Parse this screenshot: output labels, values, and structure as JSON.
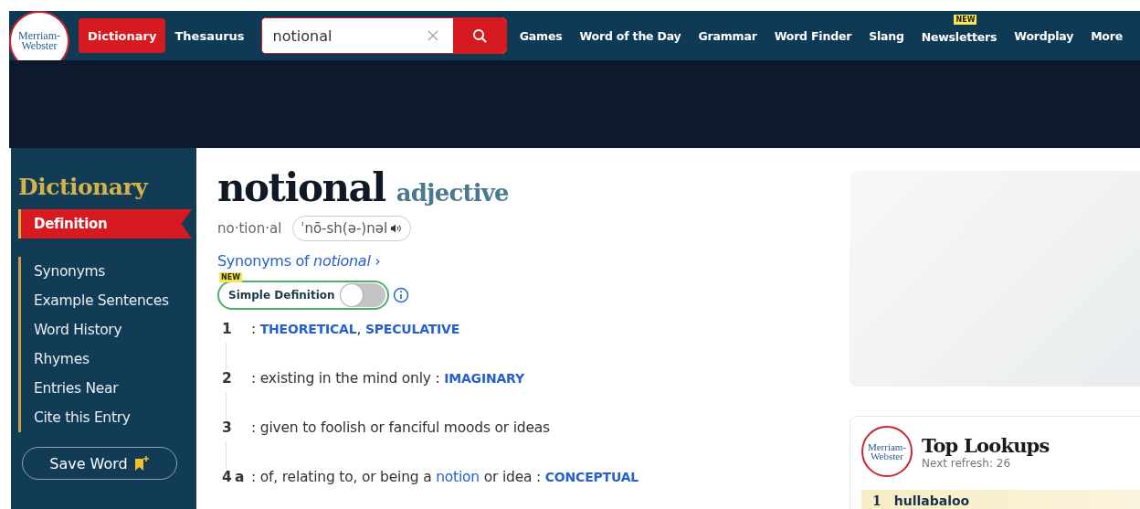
{
  "header": {
    "logo": [
      "Merriam-",
      "Webster"
    ],
    "tabs": [
      {
        "label": "Dictionary",
        "selected": true
      },
      {
        "label": "Thesaurus",
        "selected": false
      }
    ],
    "search": {
      "value": "notional"
    },
    "nav": [
      {
        "label": "Games"
      },
      {
        "label": "Word of the Day"
      },
      {
        "label": "Grammar"
      },
      {
        "label": "Word Finder"
      },
      {
        "label": "Slang"
      },
      {
        "label": "Newsletters",
        "badge": "NEW"
      },
      {
        "label": "Wordplay"
      },
      {
        "label": "More"
      }
    ]
  },
  "sidebar": {
    "title": "Dictionary",
    "items": [
      {
        "label": "Definition",
        "selected": true
      },
      {
        "label": "Synonyms",
        "selected": false
      },
      {
        "label": "Example Sentences",
        "selected": false
      },
      {
        "label": "Word History",
        "selected": false
      },
      {
        "label": "Rhymes",
        "selected": false
      },
      {
        "label": "Entries Near",
        "selected": false
      },
      {
        "label": "Cite this Entry",
        "selected": false
      }
    ],
    "save_button": "Save Word"
  },
  "entry": {
    "headword": "notional",
    "pos": "adjective",
    "syllables": "no·tion·al",
    "pronunciation": "ˈnō-sh(ə-)nəl",
    "synonyms_link": {
      "text": "Synonyms of ",
      "word": "notional",
      "arrow": "›"
    },
    "simple_definition": {
      "badge": "NEW",
      "label": "Simple Definition",
      "on": false
    },
    "senses": [
      {
        "number": "1",
        "parts": [
          {
            "kind": "text",
            "text": ": "
          },
          {
            "kind": "xref",
            "text": "THEORETICAL"
          },
          {
            "kind": "text",
            "text": ", "
          },
          {
            "kind": "xref",
            "text": "SPECULATIVE"
          }
        ]
      },
      {
        "number": "2",
        "parts": [
          {
            "kind": "text",
            "text": ": existing in the mind only "
          },
          {
            "kind": "text",
            "text": ": "
          },
          {
            "kind": "xref",
            "text": "IMAGINARY"
          }
        ]
      },
      {
        "number": "3",
        "parts": [
          {
            "kind": "text",
            "text": ": given to foolish or fanciful moods or ideas"
          }
        ]
      },
      {
        "number": "4",
        "letter": "a",
        "parts": [
          {
            "kind": "text",
            "text": ": of, relating to, or being a "
          },
          {
            "kind": "link",
            "text": "notion"
          },
          {
            "kind": "text",
            "text": " or idea "
          },
          {
            "kind": "text",
            "text": ": "
          },
          {
            "kind": "xref",
            "text": "CONCEPTUAL"
          }
        ]
      }
    ]
  },
  "top_lookups": {
    "logo": [
      "Merriam-",
      "Webster"
    ],
    "title": "Top Lookups",
    "subtitle": "Next refresh: 26",
    "items": [
      {
        "rank": "1",
        "word": "hullabaloo"
      }
    ]
  }
}
